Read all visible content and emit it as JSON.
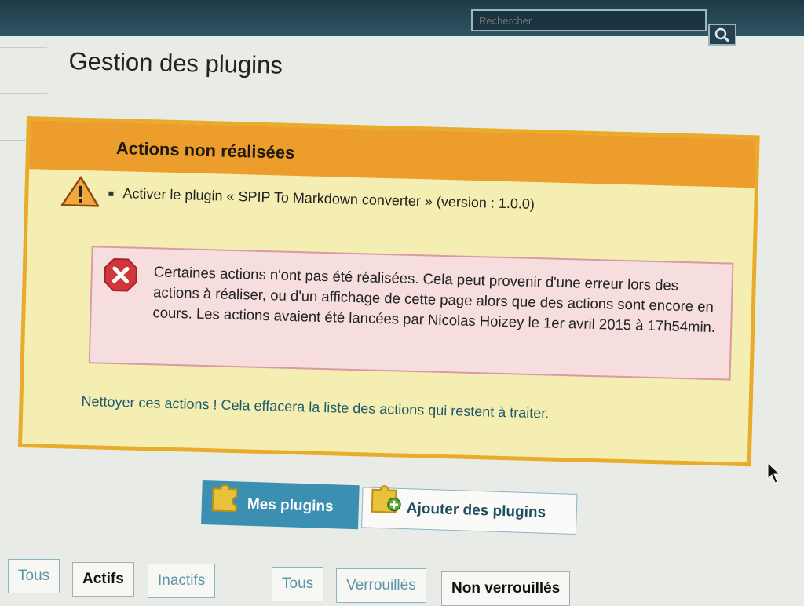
{
  "header": {
    "search_placeholder": "Rechercher"
  },
  "page": {
    "title": "Gestion des plugins"
  },
  "notice": {
    "title": "Actions non réalisées",
    "action_item": "Activer le plugin « SPIP To Markdown converter » (version : 1.0.0)",
    "error_text": "Certaines actions n'ont pas été réalisées. Cela peut provenir d'une erreur lors des actions à réaliser, ou d'un affichage de cette page alors que des actions sont encore en cours. Les actions avaient été lancées par Nicolas Hoizey le 1er avril 2015 à 17h54min.",
    "clean_link": "Nettoyer ces actions ! Cela effacera la liste des actions qui restent à traiter."
  },
  "tabs": {
    "mine": "Mes plugins",
    "add": "Ajouter des plugins"
  },
  "filters": {
    "group1": [
      "Tous",
      "Actifs",
      "Inactifs"
    ],
    "group2": [
      "Tous",
      "Verrouillés",
      "Non verrouillés"
    ],
    "selected_group1": "Actifs"
  },
  "colors": {
    "notice_border": "#e8ab2c",
    "notice_header": "#ec9d2c",
    "notice_bg": "#f4eeb2",
    "error_bg": "#f7dede",
    "error_icon": "#d2363a",
    "active_tab": "#3b8fb1"
  },
  "icons": {
    "search": "magnifier-icon",
    "warning": "warning-triangle-icon",
    "error": "error-x-icon",
    "plugins": "puzzle-icon"
  }
}
